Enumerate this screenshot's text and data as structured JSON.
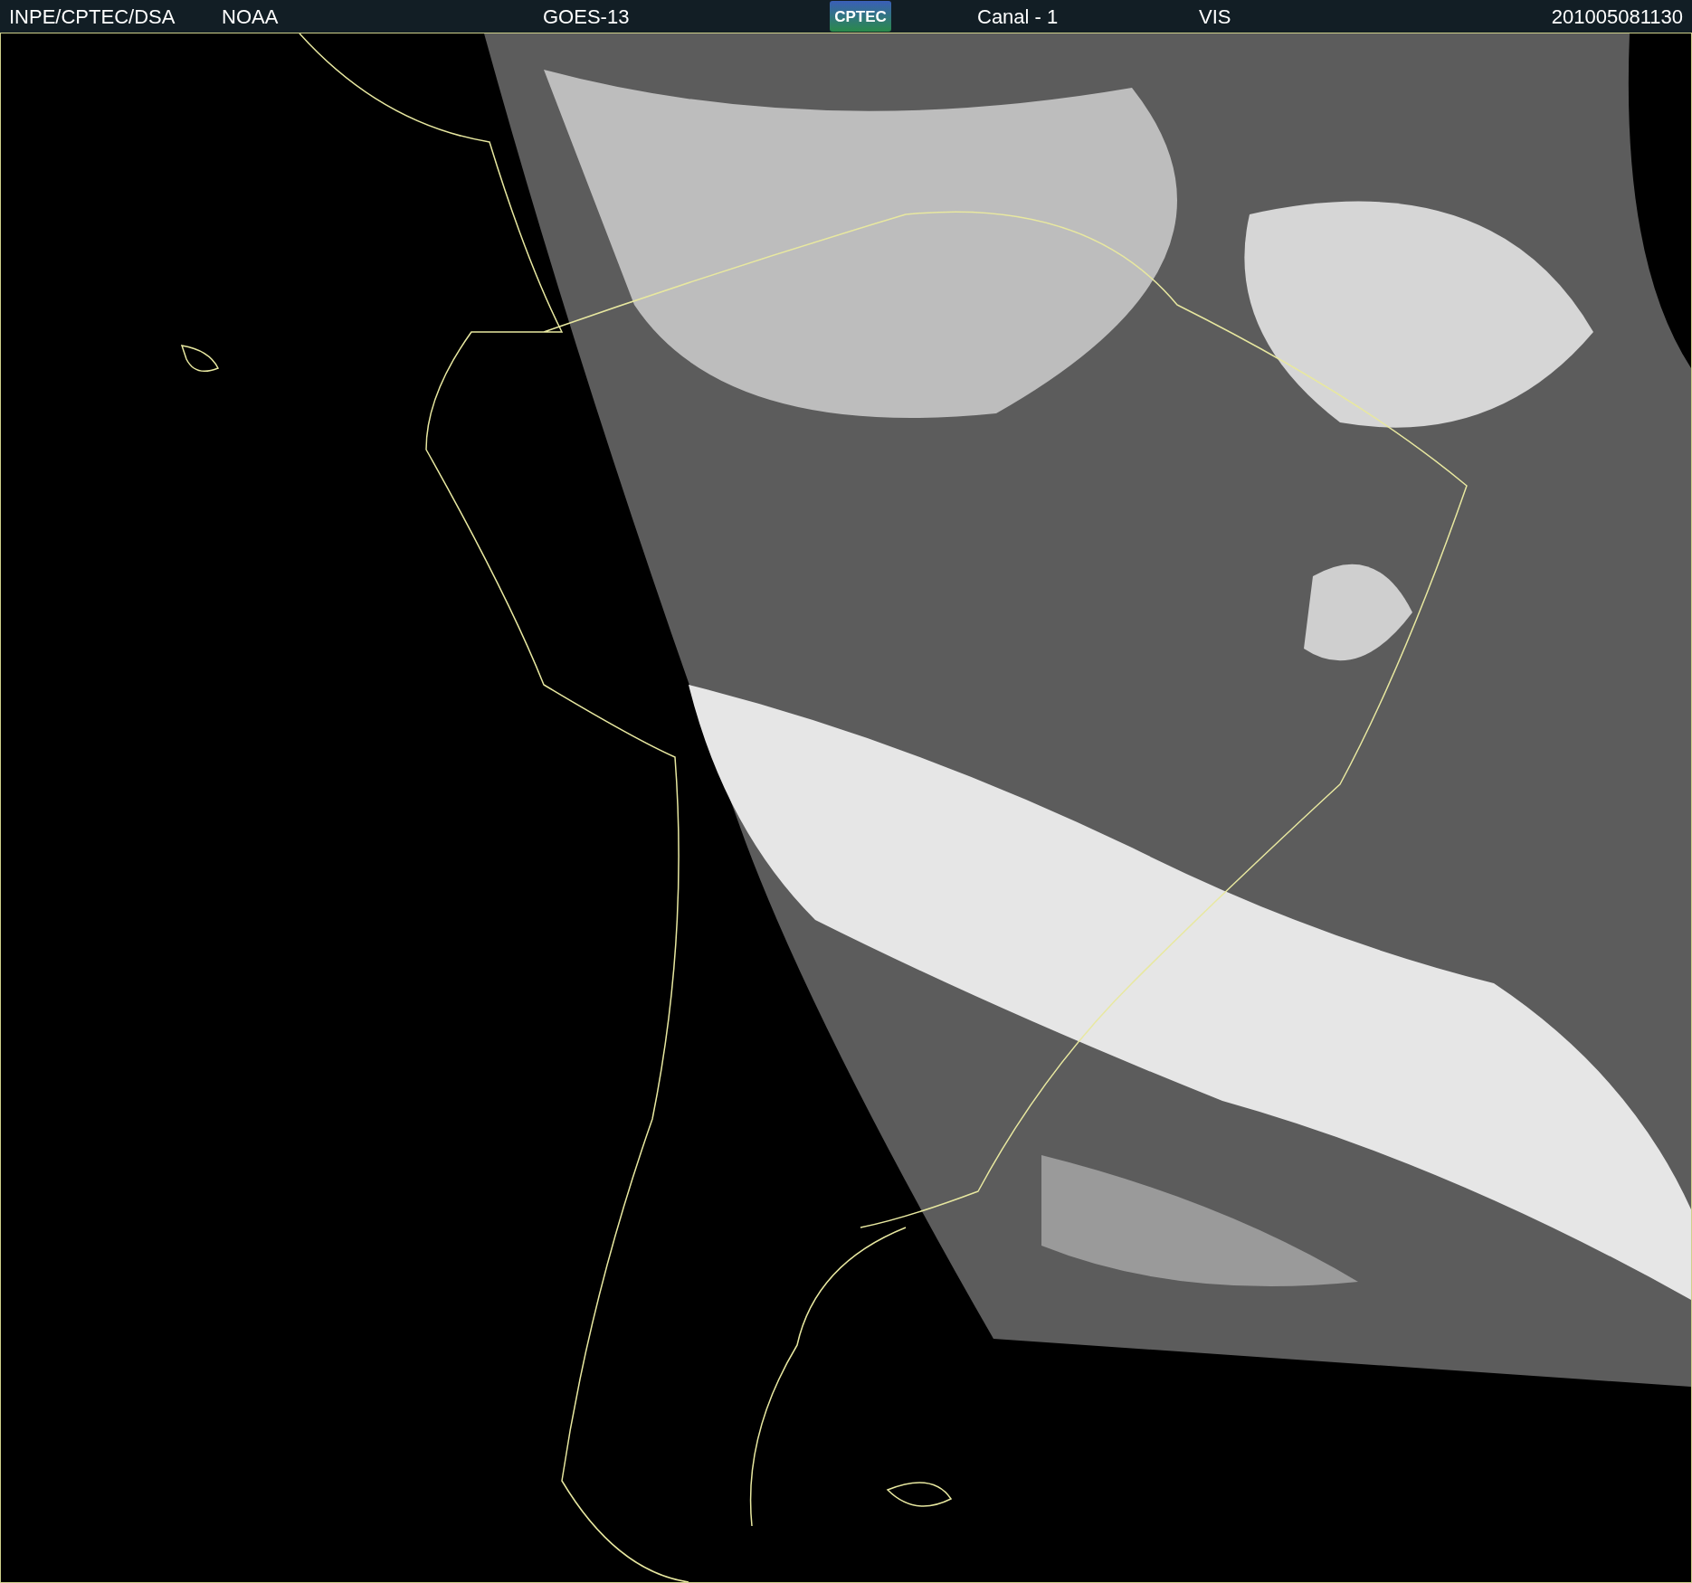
{
  "header": {
    "items": [
      {
        "kind": "text",
        "text": "INPE/CPTEC/DSA"
      },
      {
        "kind": "text",
        "text": "NOAA"
      },
      {
        "kind": "text",
        "text": "GOES-13"
      },
      {
        "kind": "logo",
        "text": "CPTEC"
      },
      {
        "kind": "text",
        "text": "Canal - 1"
      },
      {
        "kind": "text",
        "text": "VIS"
      },
      {
        "kind": "text",
        "text": "201005081130"
      }
    ]
  }
}
